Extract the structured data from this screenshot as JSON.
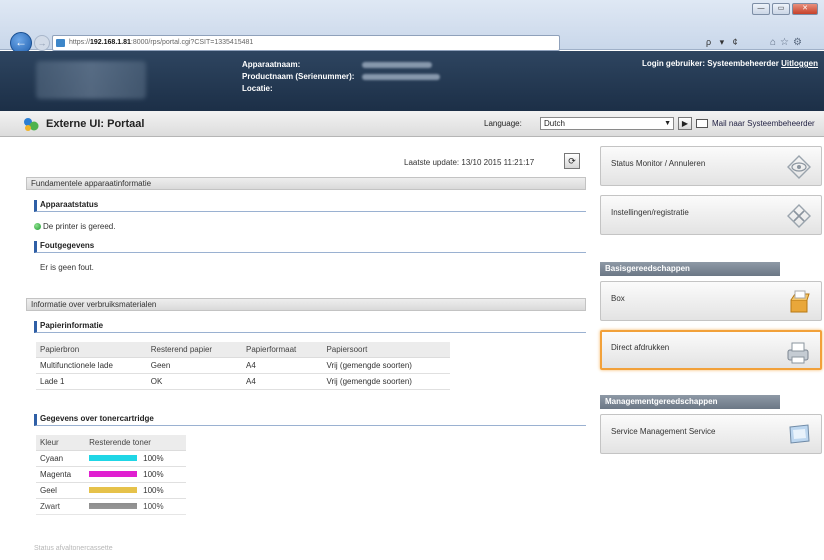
{
  "browser": {
    "url_prefix": "https://",
    "url_host": "192.168.1.81",
    "url_rest": ":8000/rps/portal.cgi?CSIT=1335415481",
    "search_hint": "ρ ▾ ¢",
    "window_buttons": [
      "—",
      "▭",
      "✕"
    ]
  },
  "header": {
    "device_name_label": "Apparaatnaam:",
    "product_name_label": "Productnaam (Serienummer):",
    "location_label": "Locatie:",
    "login_text": "Login gebruiker: Systeembeheerder",
    "logout_label": "Uitloggen"
  },
  "portal": {
    "title": "Externe UI: Portaal",
    "language_label": "Language:",
    "language_value": "Dutch",
    "mail_link": "Mail naar Systeembeheerder"
  },
  "main": {
    "last_update": "Laatste update: 13/10 2015 11:21:17",
    "basic_info_title": "Fundamentele apparaatinformatie",
    "device_status_title": "Apparaatstatus",
    "device_status_text": "De printer is gereed.",
    "error_info_title": "Foutgegevens",
    "error_info_text": "Er is geen fout.",
    "consumables_title": "Informatie over verbruiksmaterialen",
    "paper_info_title": "Papierinformatie",
    "paper_table": {
      "headers": [
        "Papierbron",
        "Resterend papier",
        "Papierformaat",
        "Papiersoort"
      ],
      "rows": [
        [
          "Multifunctionele lade",
          "Geen",
          "A4",
          "Vrij (gemengde soorten)"
        ],
        [
          "Lade 1",
          "OK",
          "A4",
          "Vrij (gemengde soorten)"
        ]
      ]
    },
    "toner_info_title": "Gegevens over tonercartridge",
    "toner_table": {
      "headers": [
        "Kleur",
        "Resterende toner"
      ],
      "rows": [
        {
          "name": "Cyaan",
          "value": "100%",
          "color": "#1fd6e6"
        },
        {
          "name": "Magenta",
          "value": "100%",
          "color": "#e01fd0"
        },
        {
          "name": "Geel",
          "value": "100%",
          "color": "#e6c24a"
        },
        {
          "name": "Zwart",
          "value": "100%",
          "color": "#888888"
        }
      ]
    },
    "faded_section": "Status afvaltonercassette"
  },
  "sidebar": {
    "status_monitor": "Status Monitor / Annuleren",
    "settings": "Instellingen/registratie",
    "basic_tools_title": "Basisgereedschappen",
    "box": "Box",
    "direct_print": "Direct afdrukken",
    "management_tools_title": "Managementgereedschappen",
    "service_management": "Service Management Service"
  }
}
